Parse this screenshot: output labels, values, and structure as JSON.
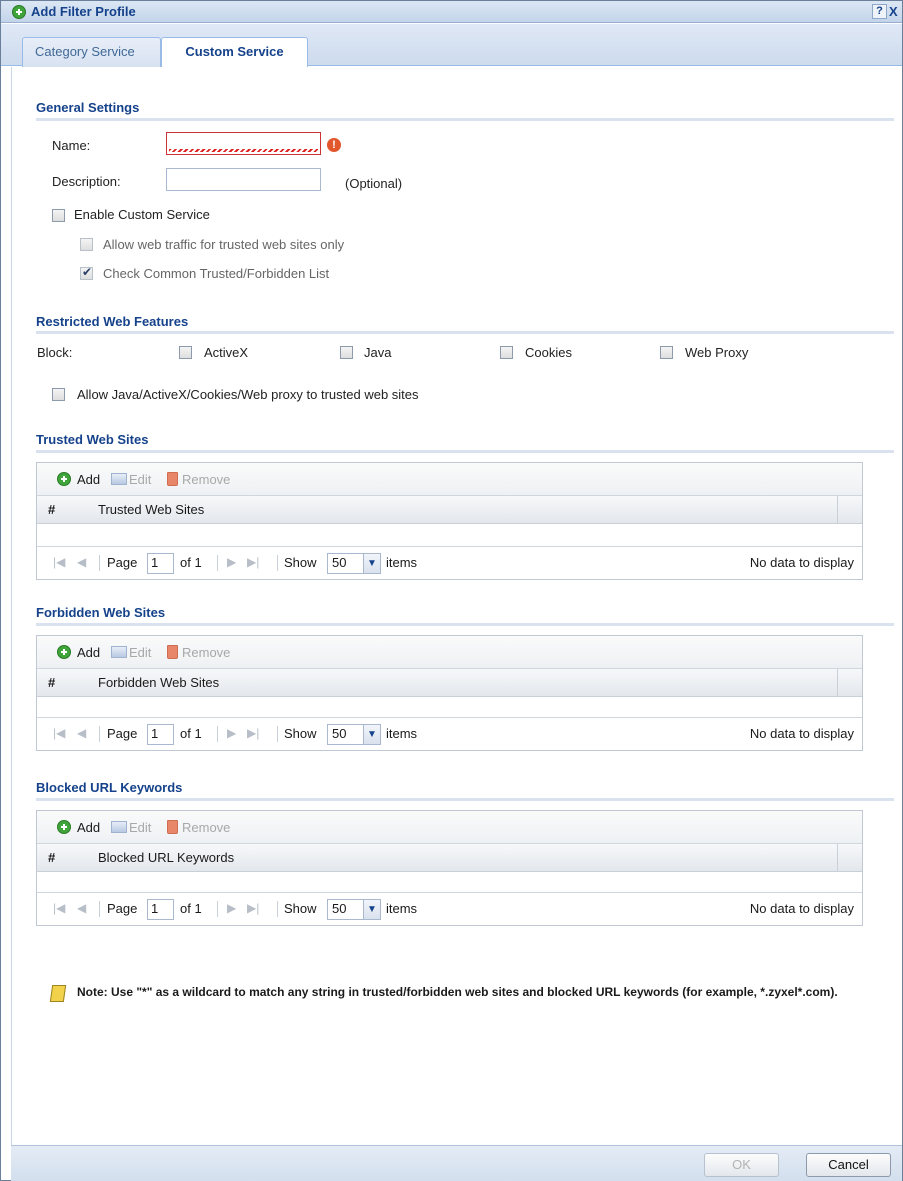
{
  "window": {
    "title": "Add Filter Profile",
    "help": "?",
    "close": "X"
  },
  "tabs": [
    {
      "label": "Category Service",
      "active": false
    },
    {
      "label": "Custom Service",
      "active": true
    }
  ],
  "general": {
    "title": "General Settings",
    "name_label": "Name:",
    "name_value": "",
    "name_error_icon": "!",
    "description_label": "Description:",
    "description_value": "",
    "optional_label": "(Optional)",
    "enable_custom_service": {
      "label": "Enable Custom Service",
      "checked": false
    },
    "allow_trusted_only": {
      "label": "Allow web traffic for trusted web sites only",
      "checked": false
    },
    "check_common_list": {
      "label": "Check Common Trusted/Forbidden List",
      "checked": true
    }
  },
  "restricted": {
    "title": "Restricted Web Features",
    "block_label": "Block:",
    "features": [
      {
        "label": "ActiveX",
        "checked": false
      },
      {
        "label": "Java",
        "checked": false
      },
      {
        "label": "Cookies",
        "checked": false
      },
      {
        "label": "Web Proxy",
        "checked": false
      }
    ],
    "allow_trusted": {
      "label": "Allow Java/ActiveX/Cookies/Web proxy to trusted web sites",
      "checked": false
    }
  },
  "toolbar": {
    "add": "Add",
    "edit": "Edit",
    "remove": "Remove"
  },
  "pager": {
    "page_label": "Page",
    "page_value": "1",
    "of_label": "of 1",
    "show_label": "Show",
    "show_value": "50",
    "items_label": "items",
    "no_data": "No data to display"
  },
  "trusted": {
    "title": "Trusted Web Sites",
    "col_hash": "#",
    "col_name": "Trusted Web Sites"
  },
  "forbidden": {
    "title": "Forbidden Web Sites",
    "col_hash": "#",
    "col_name": "Forbidden Web Sites"
  },
  "keywords": {
    "title": "Blocked URL Keywords",
    "col_hash": "#",
    "col_name": "Blocked URL Keywords"
  },
  "note": "Note: Use \"*\" as a wildcard to match any string in trusted/forbidden web sites and blocked URL keywords (for example, *.zyxel*.com).",
  "footer": {
    "ok": "OK",
    "cancel": "Cancel"
  },
  "colors": {
    "accent": "#15428b",
    "error": "#e2572b",
    "add_green": "#3fa43a"
  }
}
